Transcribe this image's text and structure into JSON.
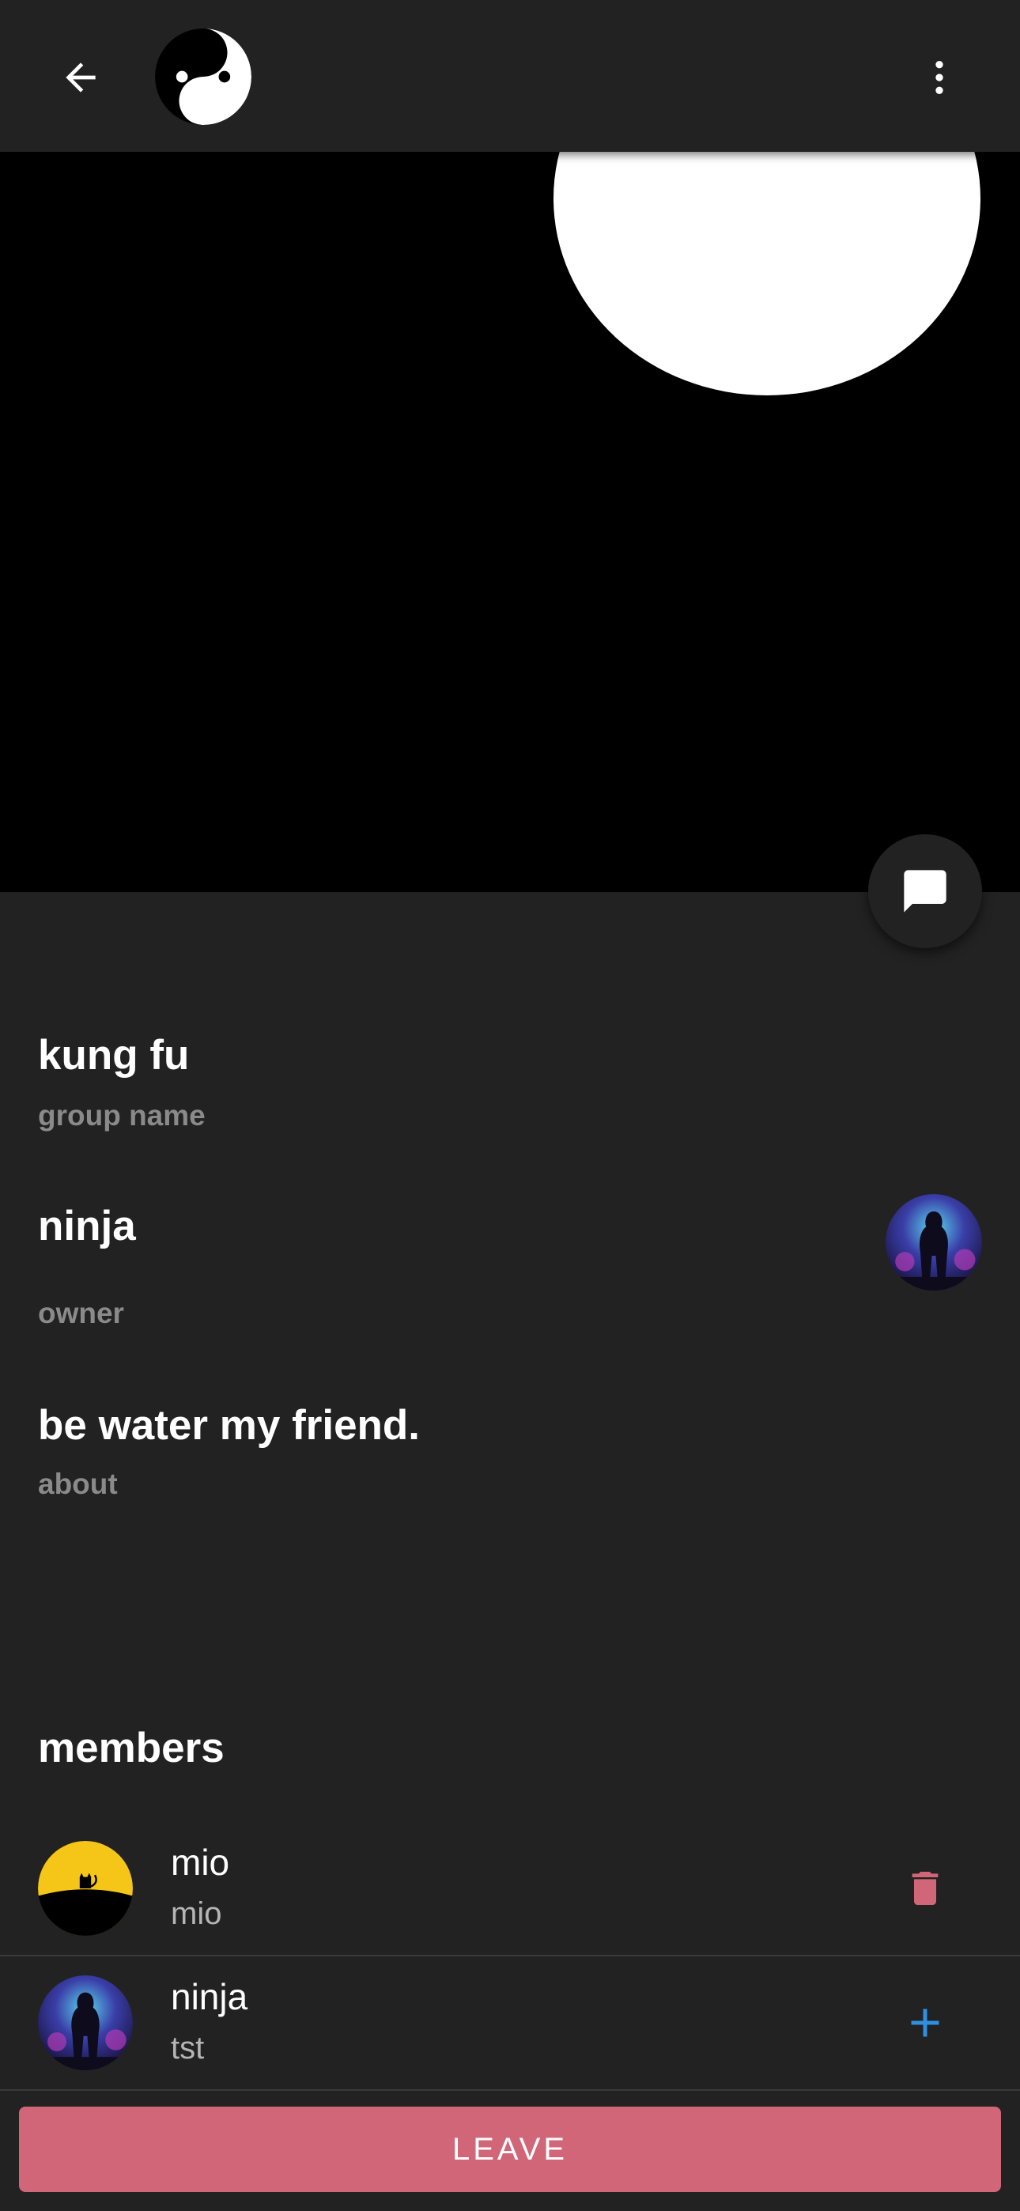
{
  "colors": {
    "background": "#222222",
    "hero_background": "#000000",
    "label_gray": "#8a8a8a",
    "danger": "#d06678",
    "accent_blue": "#2f8fe0"
  },
  "icons": {
    "back": "arrow-left-icon",
    "more": "more-vertical-icon",
    "chat": "chat-bubble-icon",
    "delete": "trash-icon",
    "add": "plus-icon"
  },
  "group": {
    "name": "kung fu",
    "name_label": "group name",
    "owner": "ninja",
    "owner_label": "owner",
    "about": "be water my friend.",
    "about_label": "about"
  },
  "members_title": "members",
  "members": [
    {
      "name": "mio",
      "subtitle": "mio",
      "action": "delete"
    },
    {
      "name": "ninja",
      "subtitle": "tst",
      "action": "add"
    }
  ],
  "leave_label": "LEAVE"
}
